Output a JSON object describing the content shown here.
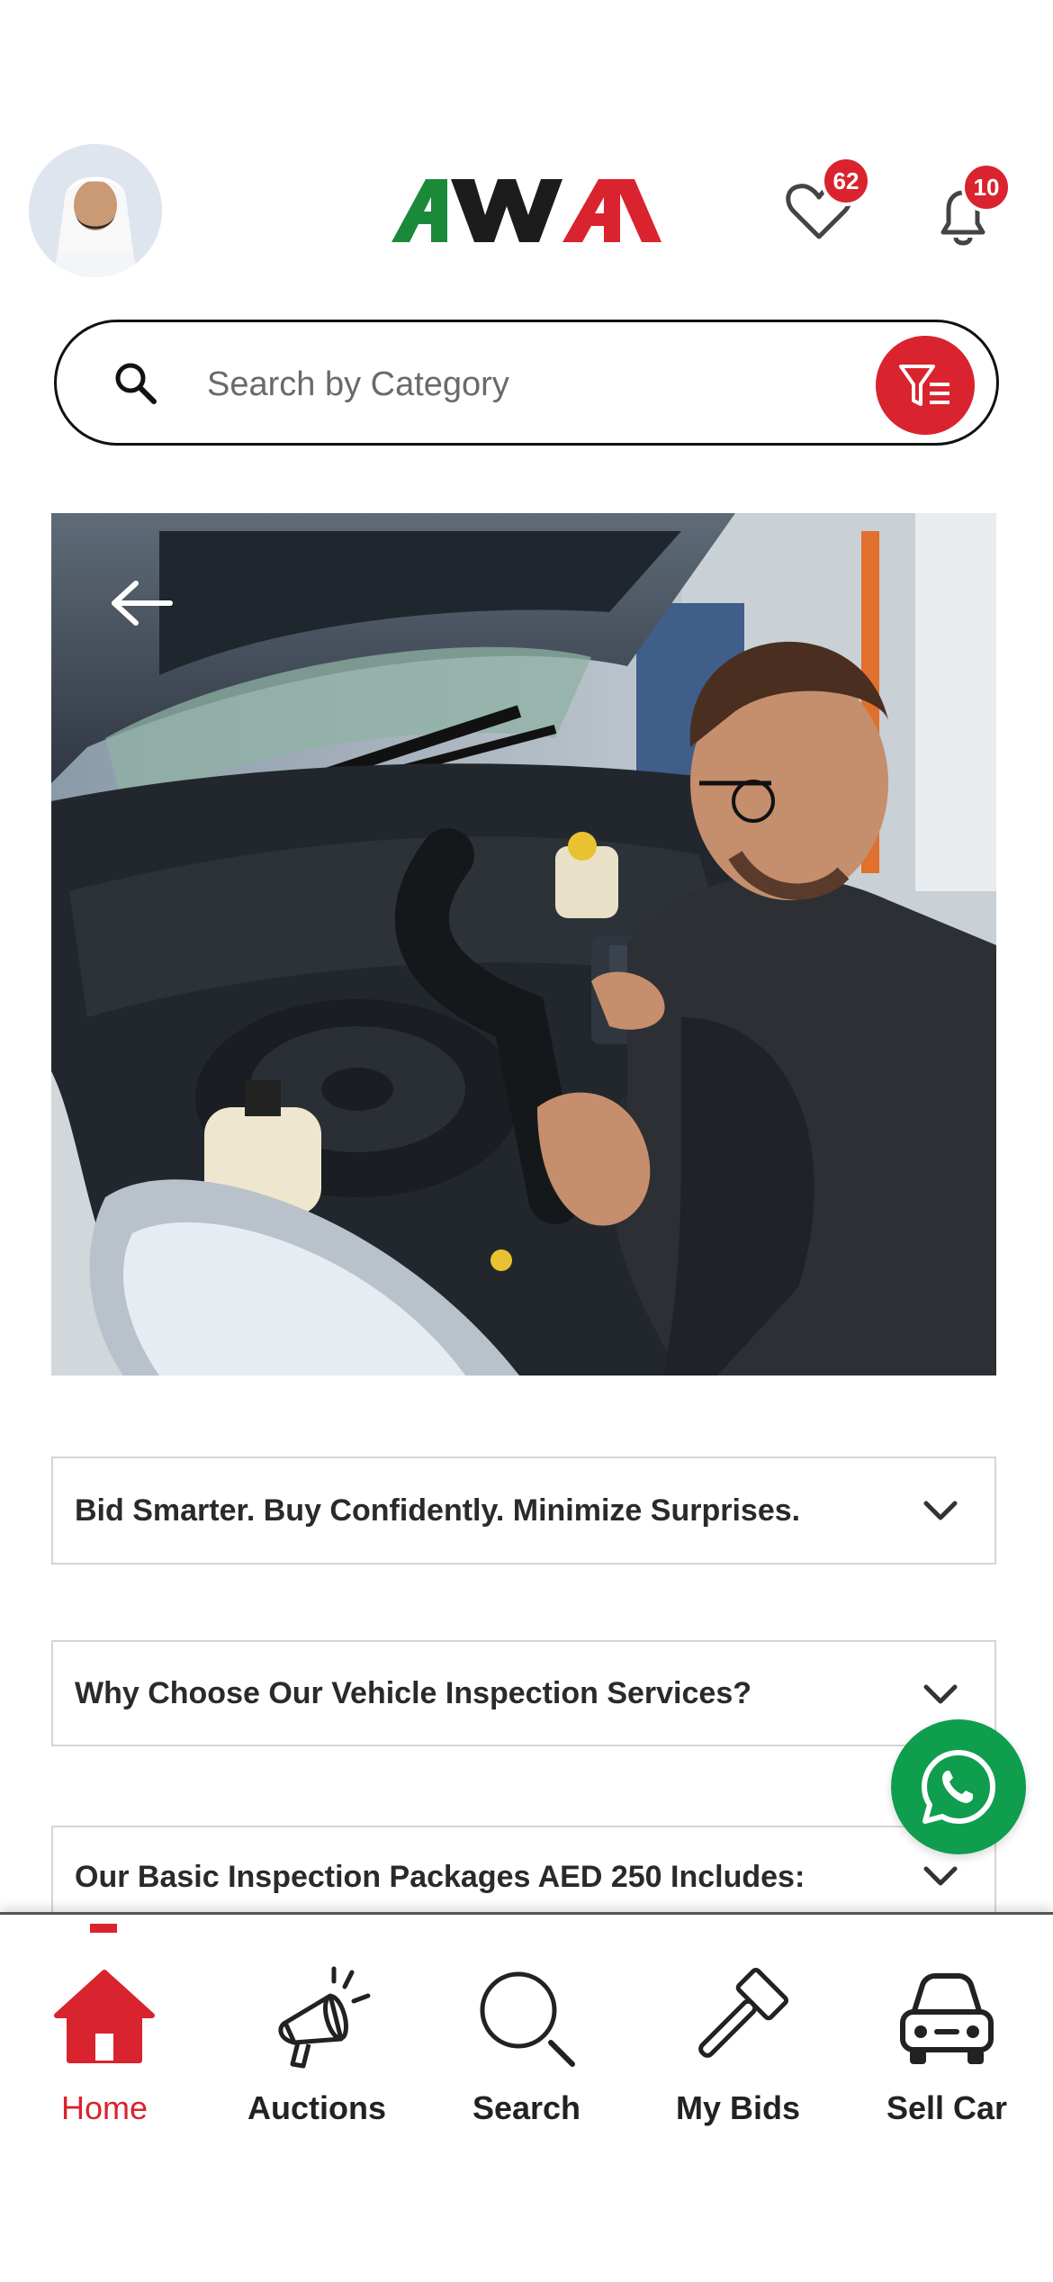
{
  "header": {
    "avatar_alt": "User profile",
    "logo_text": "AWA",
    "wishlist_count": "62",
    "notifications_count": "10"
  },
  "search": {
    "placeholder": "Search by Category"
  },
  "hero": {
    "description": "Mechanic inspecting a car engine"
  },
  "accordions": [
    {
      "title": "Bid Smarter. Buy Confidently. Minimize Surprises."
    },
    {
      "title": "Why Choose Our Vehicle Inspection Services?"
    },
    {
      "title": "Our Basic Inspection Packages AED 250 Includes:"
    }
  ],
  "nav": {
    "items": [
      {
        "label": "Home",
        "icon": "home-icon",
        "active": true
      },
      {
        "label": "Auctions",
        "icon": "megaphone-icon"
      },
      {
        "label": "Search",
        "icon": "search-icon"
      },
      {
        "label": "My Bids",
        "icon": "gavel-icon"
      },
      {
        "label": "Sell Car",
        "icon": "car-icon"
      }
    ]
  },
  "colors": {
    "accent": "#d9232e",
    "whatsapp": "#0f9d4e",
    "logo_green": "#1a8a3a"
  }
}
